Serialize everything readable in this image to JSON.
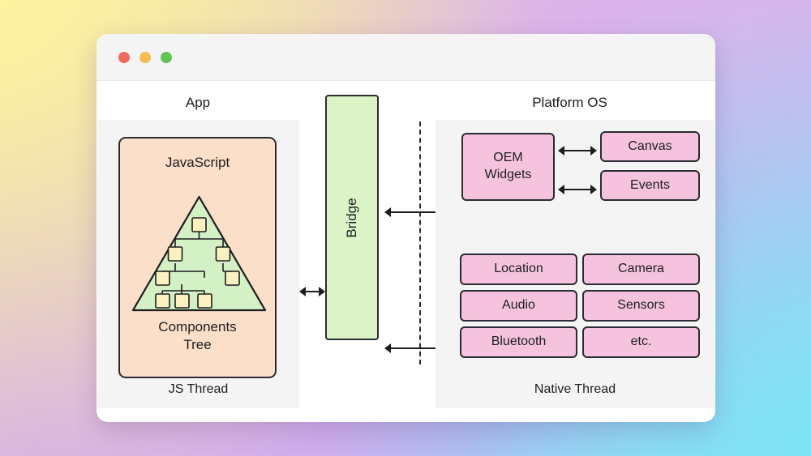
{
  "window": {
    "traffic_lights": [
      "close",
      "minimize",
      "maximize"
    ]
  },
  "diagram": {
    "title_left": "App",
    "title_right": "Platform OS",
    "footer_left": "JS Thread",
    "footer_right": "Native Thread",
    "js_card": {
      "top_label": "JavaScript",
      "bottom_label": "Components\nTree",
      "bottom_label_line1": "Components",
      "bottom_label_line2": "Tree"
    },
    "bridge": {
      "label": "Bridge"
    },
    "oem": {
      "label": "OEM\nWidgets",
      "line1": "OEM",
      "line2": "Widgets"
    },
    "ui_modules": [
      {
        "label": "Canvas"
      },
      {
        "label": "Events"
      }
    ],
    "native_modules": [
      {
        "label": "Location"
      },
      {
        "label": "Camera"
      },
      {
        "label": "Audio"
      },
      {
        "label": "Sensors"
      },
      {
        "label": "Bluetooth"
      },
      {
        "label": "etc."
      }
    ],
    "colors": {
      "js_card_fill": "#FBDFC8",
      "bridge_fill": "#DCF3C8",
      "tree_fill": "#D4F1C5",
      "node_fill": "#FAF0C0",
      "pink_fill": "#F6C3DE",
      "stroke": "#2B2B33",
      "panel_bg": "#F4F4F4"
    }
  }
}
